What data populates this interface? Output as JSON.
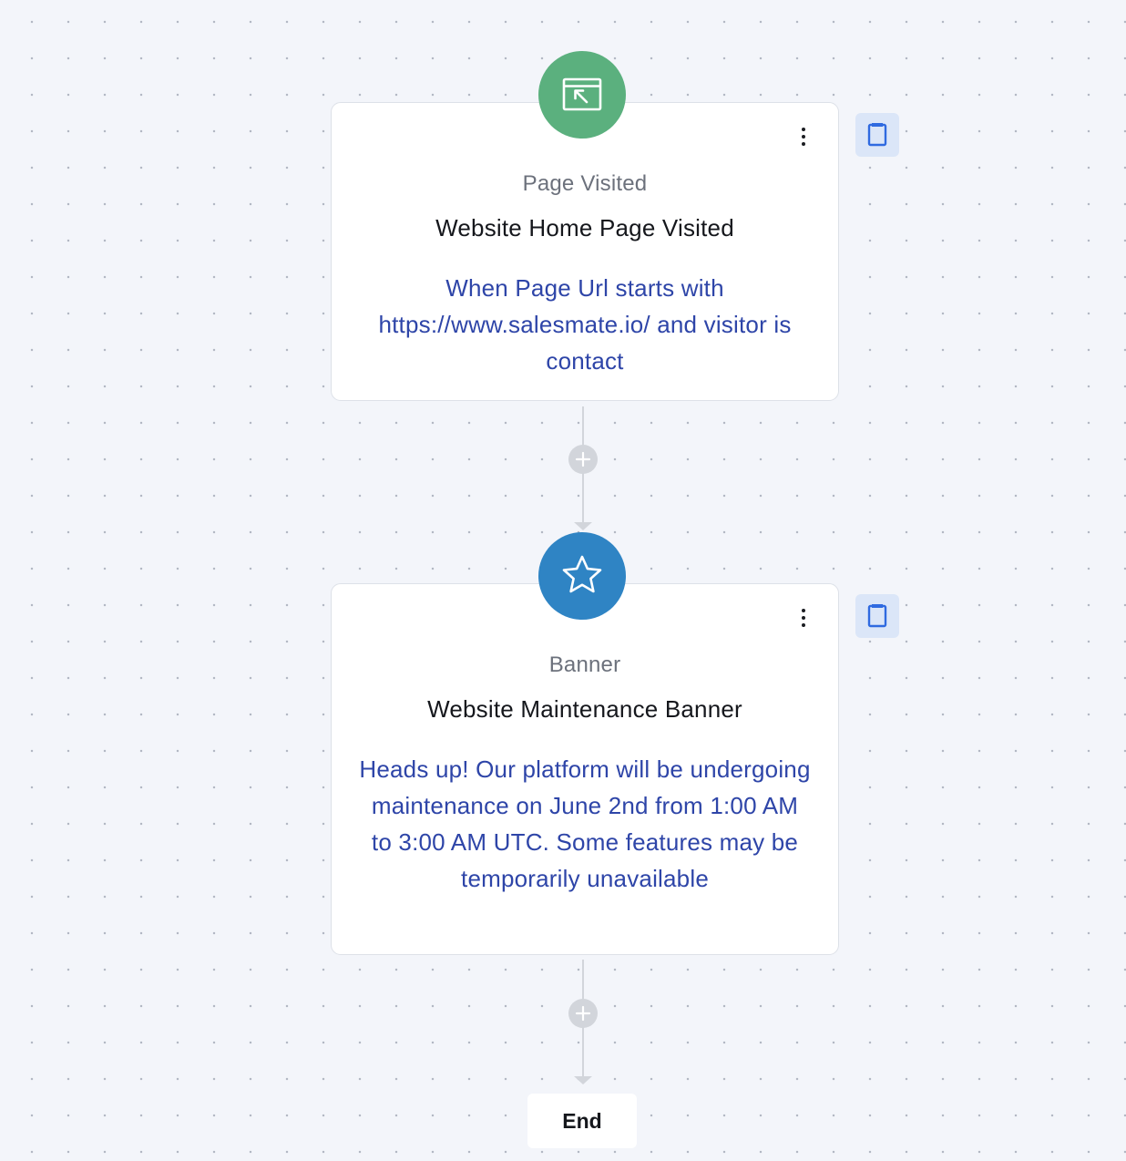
{
  "nodes": [
    {
      "type_label": "Page Visited",
      "title": "Website Home Page Visited",
      "description": "When Page Url starts with https://www.salesmate.io/ and visitor is contact",
      "icon": "page-visited-icon",
      "icon_color": "#5bb07e"
    },
    {
      "type_label": "Banner",
      "title": "Website Maintenance Banner",
      "description": "Heads up! Our platform will be undergoing maintenance on June 2nd from 1:00 AM to 3:00 AM UTC. Some features may be temporarily unavailable",
      "icon": "star-icon",
      "icon_color": "#2f84c4"
    }
  ],
  "end_label": "End",
  "colors": {
    "background": "#f3f5fa",
    "card": "#ffffff",
    "description_text": "#2e45a8",
    "connector": "#d2d5db",
    "note_button_bg": "#dbe6f8",
    "note_icon": "#2f6ae0"
  }
}
